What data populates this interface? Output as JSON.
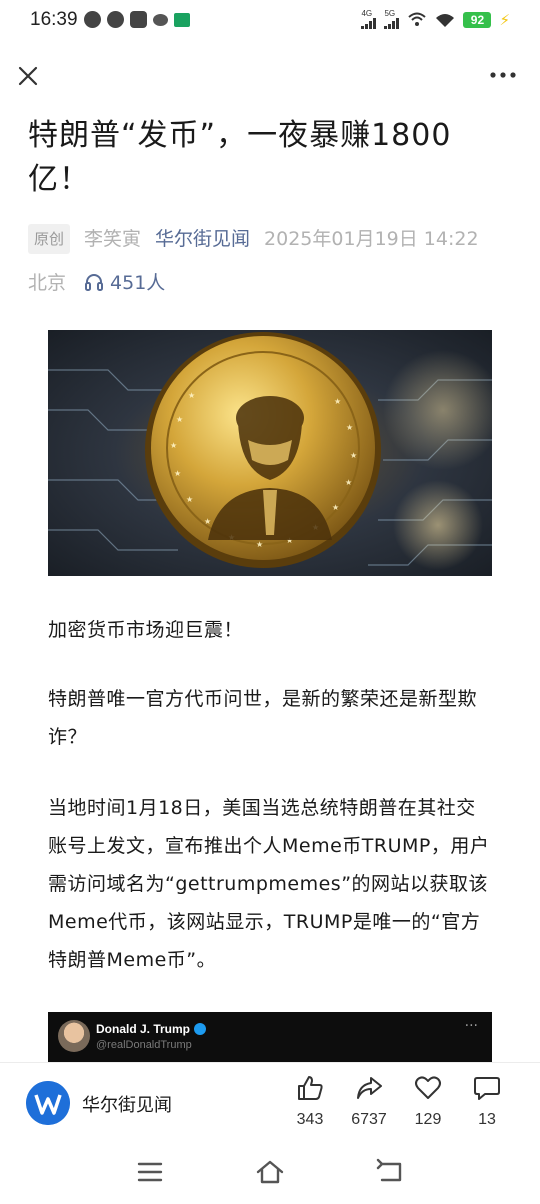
{
  "status_bar": {
    "time": "16:39",
    "net1": "4G",
    "net2": "5G",
    "battery": "92"
  },
  "article": {
    "title": "特朗普“发币”，一夜暴赚1800亿！",
    "original_tag": "原创",
    "author": "李笑寅",
    "source": "华尔街见闻",
    "datetime": "2025年01月19日 14:22",
    "location": "北京",
    "listeners": "451人",
    "paragraphs": [
      "加密货币市场迎巨震！",
      "特朗普唯一官方代币问世，是新的繁荣还是新型欺诈？",
      "当地时间1月18日，美国当选总统特朗普在其社交账号上发文，宣布推出个人Meme币TRUMP，用户需访问域名为“gettrumpmemes”的网站以获取该Meme代币，该网站显示，TRUMP是唯一的“官方特朗普Meme币”。"
    ]
  },
  "tweet": {
    "name": "Donald J. Trump",
    "handle": "@realDonaldTrump",
    "more": "···"
  },
  "bottom_bar": {
    "account_name": "华尔街见闻",
    "like_count": "343",
    "share_count": "6737",
    "favorite_count": "129",
    "comment_count": "13"
  },
  "colors": {
    "link_blue": "#576b95",
    "meta_gray": "#b2b2b2",
    "account_logo": "#1e6fd9"
  }
}
